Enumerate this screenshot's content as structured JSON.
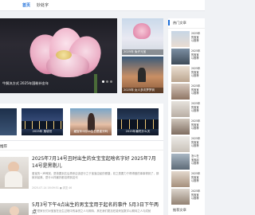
{
  "nav": {
    "items": [
      "首页",
      "妙处字"
    ],
    "active_color": "#1e6fd9"
  },
  "hero": {
    "caption": "牛解决方式 2025年国粉补金年",
    "slides": 3,
    "active_slide": 1
  },
  "hero_side": [
    {
      "caption": "2025年 兔仔元宝"
    },
    {
      "caption": "2025年 女人多次梦梦到"
    }
  ],
  "strip": [
    {
      "caption": ""
    },
    {
      "caption": "2025年 鬼坡世"
    },
    {
      "caption": "藏宝年9月25生日是星宗吗"
    },
    {
      "caption": "2025年最吃什么天"
    }
  ],
  "list": {
    "section": "推荐",
    "articles": [
      {
        "title": "2025年7月14号丑时出生的女宝宝起啥名字好 2025年7月14号是黑剔儿",
        "excerpt": "爱宝的一声啼哭，是快要到达后再来应该进行之于宝宝应起的便捷，初之是要力于得得做的事事得到了，那就拿起美、是什么样最好都没得到这代",
        "meta": "2025-07-14 16:09:51  ● 浏览 46"
      },
      {
        "title": "5月3号下午4点出生的男宝宝用于起名的事件 5月3日下午两点",
        "excerpt": "一个是家长们对宝宝在出生过程中的喜悦之人与期待，其在我们更加在能来加数字以期待之人与成就",
        "meta": ""
      }
    ]
  },
  "sidebar": {
    "heading": "热门文章",
    "items": [
      {
        "text": "2025年\n的宝宝\n以推荐"
      },
      {
        "text": "2025年\n的宝宝\n以推荐"
      },
      {
        "text": "2025年\n的宝宝\n以推荐"
      },
      {
        "text": "2025年\n的宝宝\n以推荐"
      },
      {
        "text": "2025年\n的宝宝\n以推荐"
      },
      {
        "text": "2025年\n的宝宝\n以推荐"
      },
      {
        "text": "2025年\n的宝宝\n以推荐"
      },
      {
        "text": "怎么在\n宝宝起\n以推荐"
      },
      {
        "text": "2025年\n的宝宝\n以推荐"
      },
      {
        "text": "2025年\n的宝宝\n以推荐"
      }
    ],
    "heading2": "推荐文章"
  }
}
